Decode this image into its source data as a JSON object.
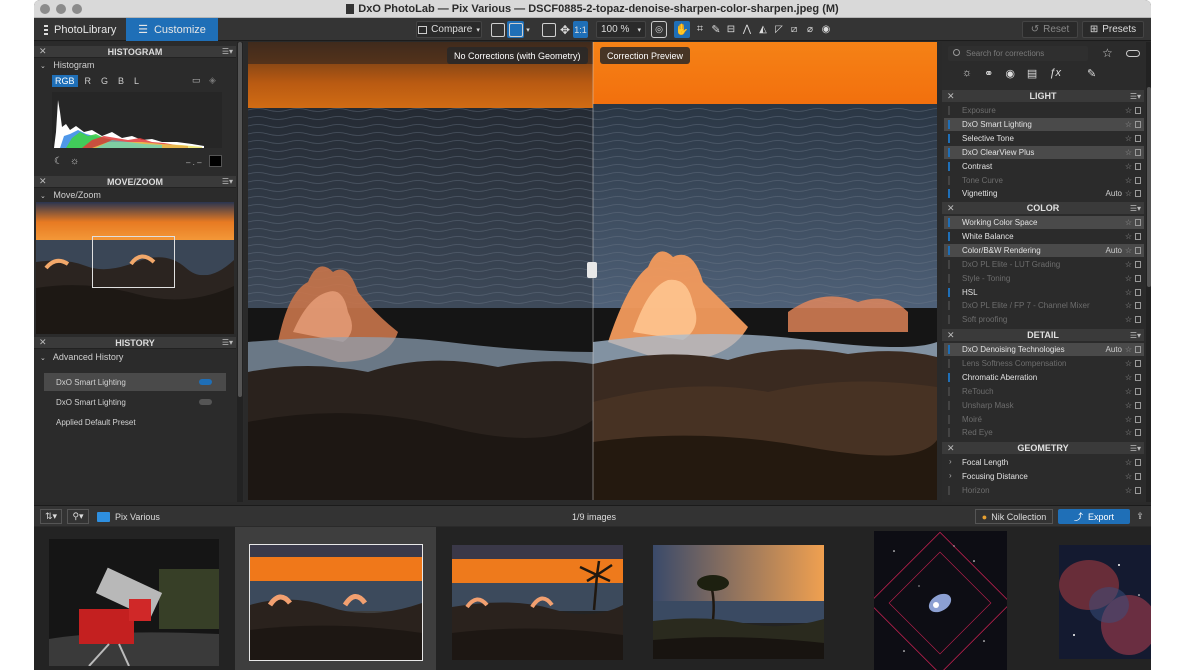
{
  "window": {
    "title": "DxO PhotoLab — Pix Various — DSCF0885-2-topaz-denoise-sharpen-color-sharpen.jpeg (M)"
  },
  "toolbar": {
    "tabs": [
      {
        "label": "PhotoLibrary",
        "active": false
      },
      {
        "label": "Customize",
        "active": true
      }
    ],
    "compare_label": "Compare",
    "zoom_one_to_one": "1:1",
    "zoom_value": "100 %",
    "reset_label": "Reset",
    "presets_label": "Presets"
  },
  "left_panel": {
    "histogram": {
      "title": "HISTOGRAM",
      "subtitle": "Histogram",
      "channels": [
        "RGB",
        "R",
        "G",
        "B",
        "L"
      ],
      "selected_channel": "RGB",
      "clip_label": "– . –"
    },
    "move_zoom": {
      "title": "MOVE/ZOOM",
      "subtitle": "Move/Zoom"
    },
    "history": {
      "title": "HISTORY",
      "subtitle": "Advanced History",
      "items": [
        {
          "label": "DxO Smart Lighting",
          "selected": true,
          "toggle": "on"
        },
        {
          "label": "DxO Smart Lighting",
          "selected": false,
          "toggle": "off"
        },
        {
          "label": "Applied Default Preset",
          "selected": false,
          "toggle": ""
        }
      ]
    }
  },
  "viewer": {
    "left_label": "No Corrections (with Geometry)",
    "right_label": "Correction Preview"
  },
  "right_panel": {
    "search_placeholder": "Search for corrections",
    "sections": [
      {
        "title": "LIGHT",
        "items": [
          {
            "label": "Exposure",
            "state": "dim",
            "auto": ""
          },
          {
            "label": "DxO Smart Lighting",
            "state": "hl",
            "auto": ""
          },
          {
            "label": "Selective Tone",
            "state": "on",
            "auto": ""
          },
          {
            "label": "DxO ClearView Plus",
            "state": "hl",
            "auto": ""
          },
          {
            "label": "Contrast",
            "state": "on",
            "auto": ""
          },
          {
            "label": "Tone Curve",
            "state": "dim",
            "auto": ""
          },
          {
            "label": "Vignetting",
            "state": "on",
            "auto": "Auto"
          }
        ]
      },
      {
        "title": "COLOR",
        "items": [
          {
            "label": "Working Color Space",
            "state": "hl",
            "auto": ""
          },
          {
            "label": "White Balance",
            "state": "on",
            "auto": ""
          },
          {
            "label": "Color/B&W Rendering",
            "state": "hl",
            "auto": "Auto"
          },
          {
            "label": "DxO PL Elite - LUT Grading",
            "state": "dim",
            "auto": ""
          },
          {
            "label": "Style - Toning",
            "state": "dim",
            "auto": ""
          },
          {
            "label": "HSL",
            "state": "on",
            "auto": ""
          },
          {
            "label": "DxO PL Elite / FP 7 - Channel Mixer",
            "state": "dim",
            "auto": ""
          },
          {
            "label": "Soft proofing",
            "state": "dim",
            "auto": ""
          }
        ]
      },
      {
        "title": "DETAIL",
        "items": [
          {
            "label": "DxO Denoising Technologies",
            "state": "hl",
            "auto": "Auto"
          },
          {
            "label": "Lens Softness Compensation",
            "state": "dim",
            "auto": ""
          },
          {
            "label": "Chromatic Aberration",
            "state": "on",
            "auto": ""
          },
          {
            "label": "ReTouch",
            "state": "dim",
            "auto": ""
          },
          {
            "label": "Unsharp Mask",
            "state": "dim",
            "auto": ""
          },
          {
            "label": "Moiré",
            "state": "dim",
            "auto": ""
          },
          {
            "label": "Red Eye",
            "state": "dim",
            "auto": ""
          }
        ]
      },
      {
        "title": "GEOMETRY",
        "items": [
          {
            "label": "Focal Length",
            "state": "arrow",
            "auto": ""
          },
          {
            "label": "Focusing Distance",
            "state": "arrow",
            "auto": ""
          },
          {
            "label": "Horizon",
            "state": "dim",
            "auto": ""
          }
        ]
      }
    ]
  },
  "bottom_bar": {
    "folder_name": "Pix Various",
    "image_count": "1/9 images",
    "nik_label": "Nik Collection",
    "export_label": "Export"
  },
  "colors": {
    "accent": "#1f6fb7",
    "panel_bg": "#2b2b2b",
    "sky_orange": "#f07a14"
  },
  "filmstrip": {
    "selected_index": 1,
    "count": 6
  }
}
